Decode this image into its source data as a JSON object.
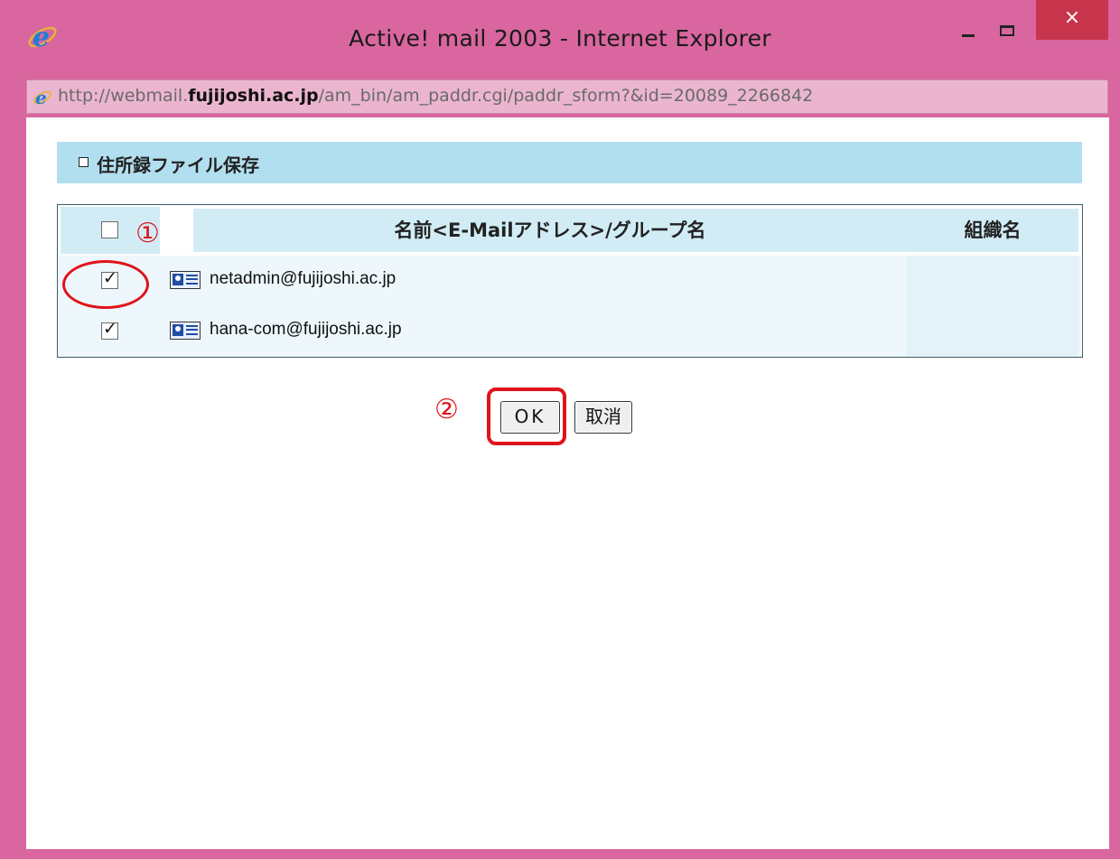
{
  "window": {
    "title": "Active! mail 2003 - Internet Explorer",
    "close_glyph": "×",
    "address": {
      "prefix": "http://webmail.",
      "host": "fujijoshi.ac.jp",
      "path": "/am_bin/am_paddr.cgi/paddr_sform?&id=20089_2266842"
    },
    "frame_color": "#d9669f",
    "close_color": "#c7354c"
  },
  "section": {
    "title": "住所録ファイル保存"
  },
  "table": {
    "columns": {
      "name": "名前<E-Mailアドレス>/グループ名",
      "org": "組織名"
    },
    "rows": [
      {
        "email": "netadmin@fujijoshi.ac.jp",
        "checked": true,
        "org": ""
      },
      {
        "email": "hana-com@fujijoshi.ac.jp",
        "checked": true,
        "org": ""
      }
    ]
  },
  "buttons": {
    "ok": "OK",
    "cancel": "取消"
  },
  "annotations": {
    "step1": "①",
    "step2": "②",
    "highlight_color": "#e0131b"
  }
}
